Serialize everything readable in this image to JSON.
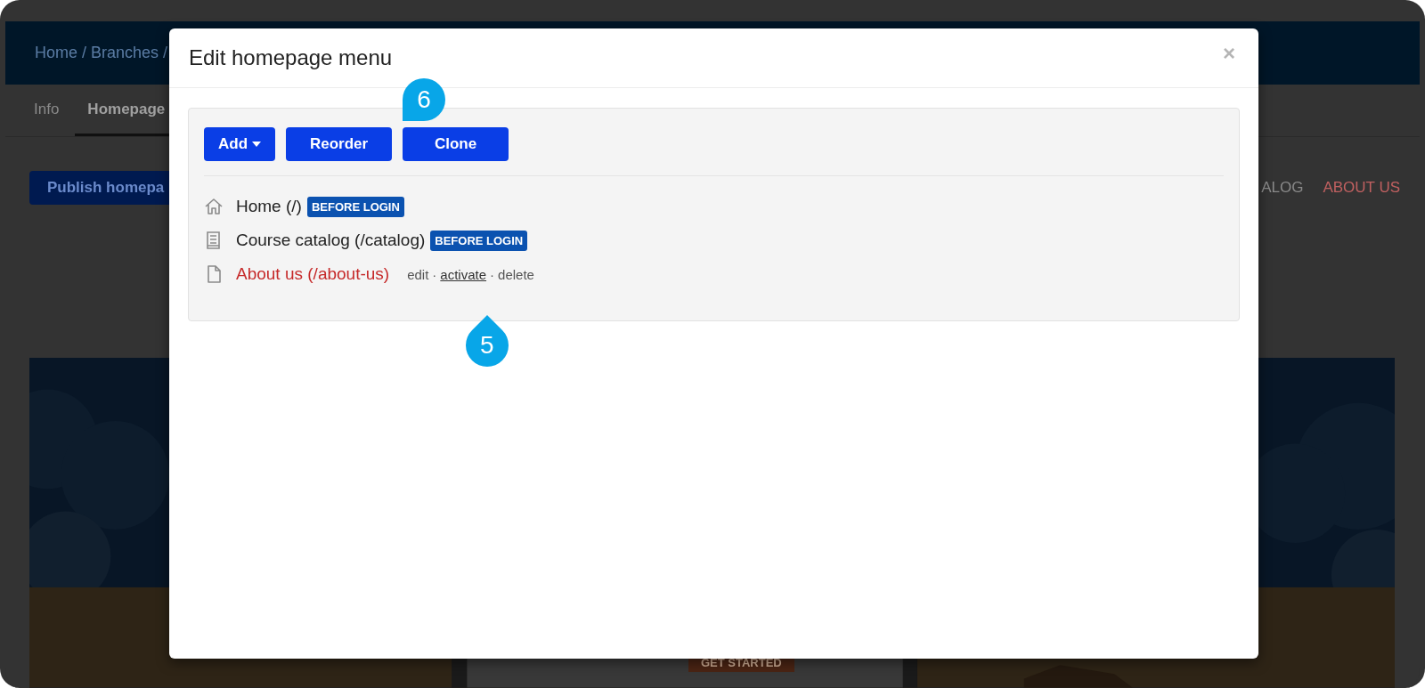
{
  "background": {
    "breadcrumb": "Home / Branches /",
    "tabs": [
      {
        "label": "Info",
        "selected": false
      },
      {
        "label": "Homepage",
        "selected": true
      }
    ],
    "publish_button": "Publish homepa",
    "site_menu": [
      {
        "label": "ALOG",
        "selected": false
      },
      {
        "label": "ABOUT US",
        "selected": true
      }
    ],
    "hero": {
      "kind": "picture",
      "button": "GET STARTED"
    }
  },
  "modal": {
    "title": "Edit homepage menu",
    "close": "×",
    "buttons": [
      {
        "label": "Add",
        "kind": "dropdown"
      },
      {
        "label": "Reorder",
        "kind": "plain"
      },
      {
        "label": "Clone",
        "kind": "plain"
      }
    ],
    "items": [
      {
        "kind": "home",
        "label": "Home (/)",
        "active": true,
        "badge": "BEFORE LOGIN"
      },
      {
        "kind": "catalog",
        "label": "Course catalog (/catalog)",
        "active": true,
        "badge": "BEFORE LOGIN"
      },
      {
        "kind": "page",
        "label": "About us (/about-us)",
        "active": false,
        "separator": "·",
        "actions": [
          {
            "label": "edit",
            "hovered": false
          },
          {
            "label": "activate",
            "hovered": true
          },
          {
            "label": "delete",
            "hovered": false
          }
        ]
      }
    ]
  },
  "callouts": [
    {
      "label": "6",
      "kind": "down-left"
    },
    {
      "label": "5",
      "kind": "up"
    }
  ]
}
